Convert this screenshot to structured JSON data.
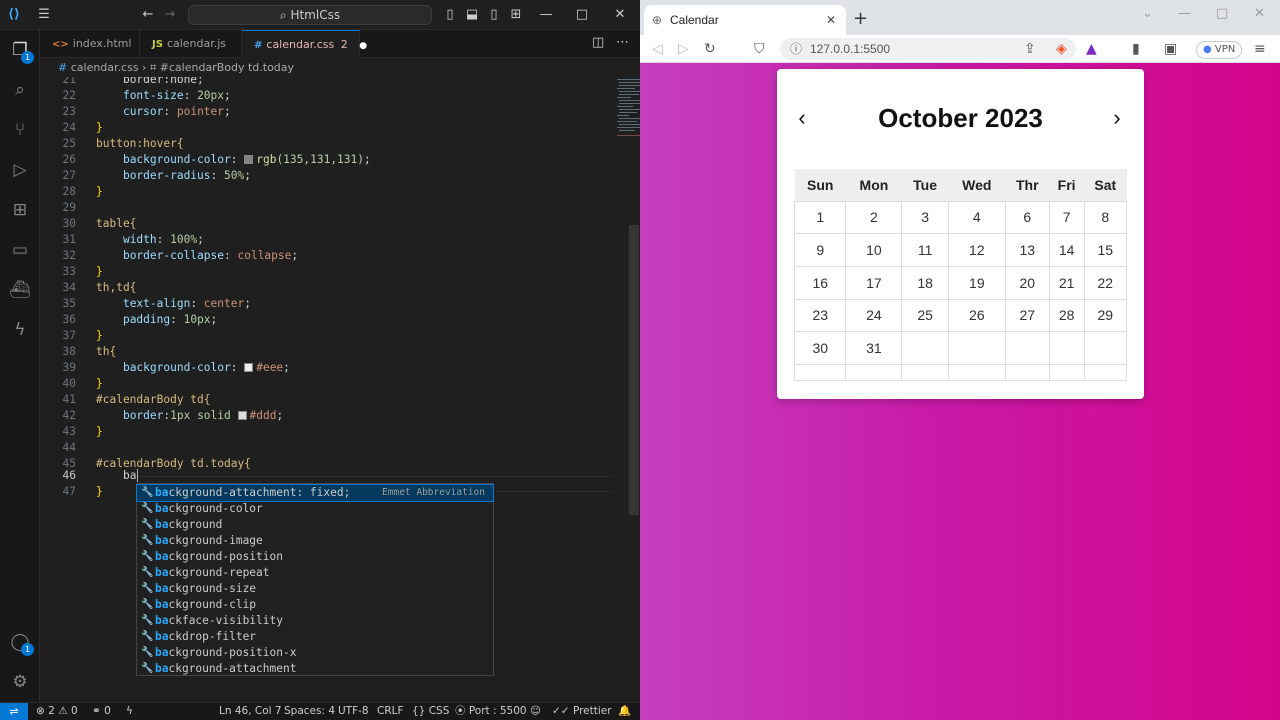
{
  "vscode": {
    "command_center": "HtmlCss",
    "tabs": [
      {
        "icon": "<>",
        "label": "index.html"
      },
      {
        "icon": "JS",
        "label": "calendar.js"
      },
      {
        "icon": "#",
        "label": "calendar.css",
        "count": "2"
      }
    ],
    "breadcrumb": {
      "file": "calendar.css",
      "symbol": "#calendarBody td.today"
    },
    "code": {
      "l21": {
        "ln": "21",
        "text": "border:none;"
      },
      "l22": {
        "ln": "22",
        "prop": "font-size",
        "val": "20px"
      },
      "l23": {
        "ln": "23",
        "prop": "cursor",
        "val": "pointer"
      },
      "l24": {
        "ln": "24",
        "text": "}"
      },
      "l25": {
        "ln": "25",
        "sel": "button:hover{"
      },
      "l26": {
        "ln": "26",
        "prop": "background-color",
        "fn": "rgb",
        "args": "(135,131,131)"
      },
      "l27": {
        "ln": "27",
        "prop": "border-radius",
        "val": "50%"
      },
      "l28": {
        "ln": "28",
        "text": "}"
      },
      "l29": {
        "ln": "29"
      },
      "l30": {
        "ln": "30",
        "sel": "table{"
      },
      "l31": {
        "ln": "31",
        "prop": "width",
        "val": "100%"
      },
      "l32": {
        "ln": "32",
        "prop": "border-collapse",
        "val": "collapse"
      },
      "l33": {
        "ln": "33",
        "text": "}"
      },
      "l34": {
        "ln": "34",
        "sel": "th,td{"
      },
      "l35": {
        "ln": "35",
        "prop": "text-align",
        "val": "center"
      },
      "l36": {
        "ln": "36",
        "prop": "padding",
        "val": "10px"
      },
      "l37": {
        "ln": "37",
        "text": "}"
      },
      "l38": {
        "ln": "38",
        "sel": "th{"
      },
      "l39": {
        "ln": "39",
        "prop": "background-color",
        "val": "#eee"
      },
      "l40": {
        "ln": "40",
        "text": "}"
      },
      "l41": {
        "ln": "41",
        "sel": "#calendarBody td{"
      },
      "l42": {
        "ln": "42",
        "prop": "border",
        "val": "1px solid",
        "color": "#ddd"
      },
      "l43": {
        "ln": "43",
        "text": "}"
      },
      "l44": {
        "ln": "44"
      },
      "l45": {
        "ln": "45",
        "sel": "#calendarBody td.today{"
      },
      "l46": {
        "ln": "46",
        "typed": "ba"
      },
      "l47": {
        "ln": "47",
        "text": "}"
      }
    },
    "swatches": {
      "rgb": "#878383",
      "eee": "#eeeeee",
      "ddd": "#dddddd"
    },
    "suggestions": {
      "typed": "ba",
      "detail": "Emmet Abbreviation",
      "items": [
        {
          "rest": "ckground-attachment: fixed;"
        },
        {
          "rest": "ckground-color"
        },
        {
          "rest": "ckground"
        },
        {
          "rest": "ckground-image"
        },
        {
          "rest": "ckground-position"
        },
        {
          "rest": "ckground-repeat"
        },
        {
          "rest": "ckground-size"
        },
        {
          "rest": "ckground-clip"
        },
        {
          "rest": "ckface-visibility"
        },
        {
          "rest": "ckdrop-filter"
        },
        {
          "rest": "ckground-position-x"
        },
        {
          "rest": "ckground-attachment"
        }
      ]
    },
    "activity_badges": {
      "explorer": "1",
      "accounts": "1"
    },
    "status": {
      "errors": "2",
      "warnings": "0",
      "ports": "0",
      "position": "Ln 46, Col 7",
      "spaces": "Spaces: 4",
      "encoding": "UTF-8",
      "eol": "CRLF",
      "language": "CSS",
      "port": "Port : 5500",
      "prettier": "Prettier"
    }
  },
  "browser": {
    "tab_title": "Calendar",
    "url": "127.0.0.1:5500",
    "vpn": "VPN",
    "calendar": {
      "title": "October 2023",
      "prev": "‹",
      "next": "›",
      "weekdays": [
        "Sun",
        "Mon",
        "Tue",
        "Wed",
        "Thr",
        "Fri",
        "Sat"
      ],
      "weeks": [
        [
          "1",
          "2",
          "3",
          "4",
          "6",
          "7",
          "8"
        ],
        [
          "9",
          "10",
          "11",
          "12",
          "13",
          "14",
          "15"
        ],
        [
          "16",
          "17",
          "18",
          "19",
          "20",
          "21",
          "22"
        ],
        [
          "23",
          "24",
          "25",
          "26",
          "27",
          "28",
          "29"
        ],
        [
          "30",
          "31",
          "",
          "",
          "",
          "",
          ""
        ],
        [
          "",
          "",
          "",
          "",
          "",
          "",
          ""
        ]
      ]
    }
  }
}
